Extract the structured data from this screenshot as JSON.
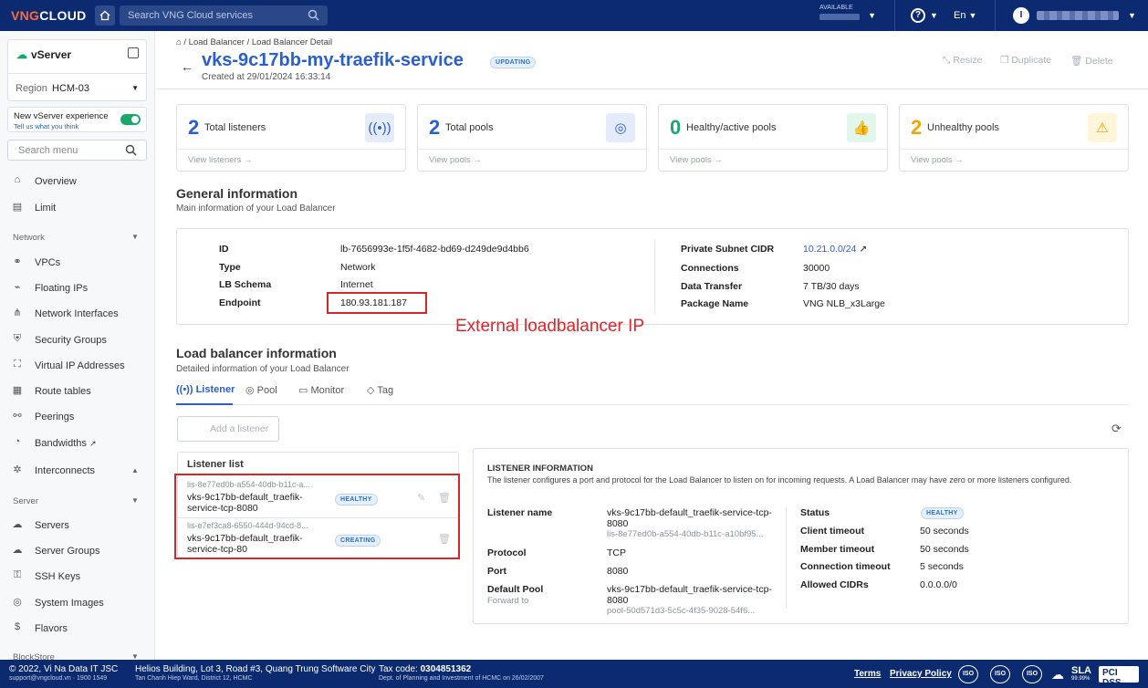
{
  "topbar": {
    "logo_a": "VNG",
    "logo_b": "CLOUD",
    "search_placeholder": "Search VNG Cloud services",
    "available_label": "AVAILABLE",
    "language": "En",
    "user_initial": "I"
  },
  "sidebar": {
    "service": "vServer",
    "region_label": "Region",
    "region_value": "HCM-03",
    "new_exp": "New vServer experience",
    "tell_us": "Tell us what you think",
    "search_placeholder": "Search menu",
    "items": [
      {
        "label": "Overview",
        "icon": "home-icon"
      },
      {
        "label": "Limit",
        "icon": "doc-icon"
      }
    ],
    "network_label": "Network",
    "network_items": [
      {
        "label": "VPCs"
      },
      {
        "label": "Floating IPs"
      },
      {
        "label": "Network Interfaces"
      },
      {
        "label": "Security Groups"
      },
      {
        "label": "Virtual IP Addresses"
      },
      {
        "label": "Route tables"
      },
      {
        "label": "Peerings"
      },
      {
        "label": "Bandwidths"
      },
      {
        "label": "Interconnects"
      }
    ],
    "server_label": "Server",
    "server_items": [
      {
        "label": "Servers"
      },
      {
        "label": "Server Groups"
      },
      {
        "label": "SSH Keys"
      },
      {
        "label": "System Images"
      },
      {
        "label": "Flavors"
      }
    ],
    "blockstore_label": "BlockStore"
  },
  "header": {
    "crumb1": "Load Balancer",
    "crumb2": "Load Balancer Detail",
    "title": "vks-9c17bb-my-traefik-service",
    "status": "UPDATING",
    "created": "Created at 29/01/2024 16:33:14",
    "resize": "Resize",
    "duplicate": "Duplicate",
    "delete": "Delete"
  },
  "cards": [
    {
      "num": "2",
      "label": "Total listeners",
      "view": "View listeners →",
      "color": "#2a5fcf",
      "icon": "listener-icon"
    },
    {
      "num": "2",
      "label": "Total pools",
      "view": "View pools →",
      "color": "#2a5fcf",
      "icon": "pool-icon"
    },
    {
      "num": "0",
      "label": "Healthy/active pools",
      "view": "View pools →",
      "color": "#1aa86a",
      "icon": "thumbs-up-icon"
    },
    {
      "num": "2",
      "label": "Unhealthy pools",
      "view": "View pools →",
      "color": "#f0a500",
      "icon": "warning-icon"
    }
  ],
  "general": {
    "title": "General information",
    "subtitle": "Main information of your Load Balancer",
    "id_label": "ID",
    "id_value": "lb-7656993e-1f5f-4682-bd69-d249de9d4bb6",
    "type_label": "Type",
    "type_value": "Network",
    "schema_label": "LB Schema",
    "schema_value": "Internet",
    "endpoint_label": "Endpoint",
    "endpoint_value": "180.93.181.187",
    "cidr_label": "Private Subnet CIDR",
    "cidr_value": "10.21.0.0/24",
    "conn_label": "Connections",
    "conn_value": "30000",
    "transfer_label": "Data Transfer",
    "transfer_value": "7 TB/30 days",
    "package_label": "Package Name",
    "package_value": "VNG NLB_x3Large"
  },
  "annotation": "External loadbalancer IP",
  "lbinfo": {
    "title": "Load balancer information",
    "subtitle": "Detailed information of your Load Balancer",
    "tabs": [
      "Listener",
      "Pool",
      "Monitor",
      "Tag"
    ],
    "add_listener": "Add a listener"
  },
  "listener_list": {
    "title": "Listener list",
    "rows": [
      {
        "id": "lis-8e77ed0b-a554-40db-b11c-a...",
        "name": "vks-9c17bb-default_traefik-service-tcp-8080",
        "status": "HEALTHY"
      },
      {
        "id": "lis-e7ef3ca8-6550-444d-94cd-8...",
        "name": "vks-9c17bb-default_traefik-service-tcp-80",
        "status": "CREATING"
      }
    ]
  },
  "listener_info": {
    "title": "LISTENER INFORMATION",
    "desc": "The listener configures a port and protocol for the Load Balancer to listen on for incoming requests. A Load Balancer may have zero or more listeners configured.",
    "name_label": "Listener name",
    "name_value": "vks-9c17bb-default_traefik-service-tcp-8080",
    "name_id": "lis-8e77ed0b-a554-40db-b11c-a10bf95...",
    "protocol_label": "Protocol",
    "protocol_value": "TCP",
    "port_label": "Port",
    "port_value": "8080",
    "pool_label": "Default Pool",
    "pool_sub": "Forward to",
    "pool_value": "vks-9c17bb-default_traefik-service-tcp-8080",
    "pool_id": "pool-50d571d3-5c5c-4f35-9028-54f6...",
    "status_label": "Status",
    "status_value": "HEALTHY",
    "client_label": "Client timeout",
    "client_value": "50 seconds",
    "member_label": "Member timeout",
    "member_value": "50 seconds",
    "conn_label": "Connection timeout",
    "conn_value": "5 seconds",
    "cidrs_label": "Allowed CIDRs",
    "cidrs_value": "0.0.0.0/0"
  },
  "footer": {
    "copyright": "© 2022, Vi Na Data IT JSC",
    "support": "support@vngcloud.vn · 1900 1549",
    "address": "Helios Building, Lot 3, Road #3, Quang Trung Software City",
    "address2": "Tan Chanh Hiep Ward, District 12, HCMC",
    "tax_label": "Tax code:",
    "tax_value": "0304851362",
    "tax2": "Dept. of Planning and Investment of HCMC on 26/02/2007",
    "terms": "Terms",
    "privacy": "Privacy Policy",
    "cert": "ISO",
    "sla": "SLA",
    "sla_value": "99.99%",
    "pci": "PCI DSS"
  }
}
